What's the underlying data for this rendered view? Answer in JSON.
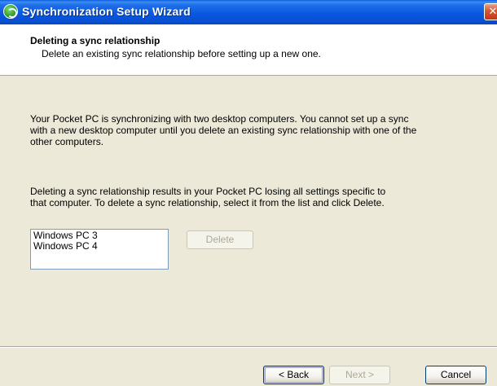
{
  "window": {
    "title": "Synchronization Setup Wizard",
    "close_glyph": "✕",
    "icon": "sync-icon"
  },
  "header": {
    "title": "Deleting a sync relationship",
    "subtitle": "Delete an existing sync relationship before setting up a new one."
  },
  "body": {
    "paragraph1": [
      "Your Pocket PC is synchronizing with two desktop computers.  You cannot set up a sync",
      "with a new desktop computer until you delete an existing sync relationship with one of the",
      "other computers."
    ],
    "paragraph2": [
      "Deleting a sync relationship results in your Pocket PC losing all settings specific to",
      "that computer.  To delete a sync relationship, select it from the list and click Delete."
    ]
  },
  "relationships": {
    "items": [
      "Windows PC 3",
      "Windows PC 4"
    ],
    "delete_label": "Delete",
    "delete_enabled": false
  },
  "footer": {
    "back_label": "< Back",
    "next_label": "Next >",
    "next_enabled": false,
    "cancel_label": "Cancel"
  },
  "colors": {
    "titlebar": "#0a58e0",
    "dialog_bg": "#ece9d8",
    "header_bg": "#ffffff",
    "disabled_text": "#aca899"
  }
}
